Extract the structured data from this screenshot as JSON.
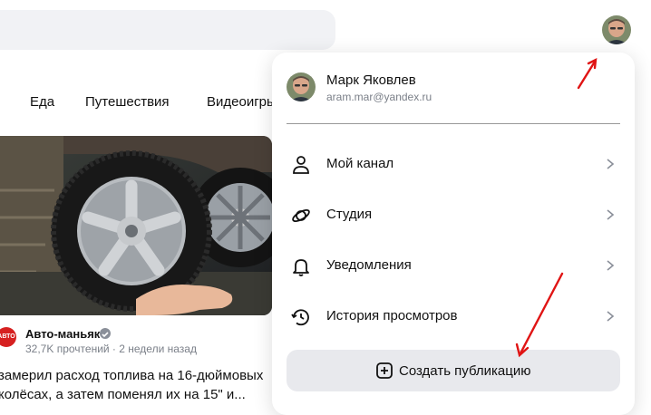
{
  "header": {
    "search_icon": "search-bar",
    "avatar_icon": "user-avatar"
  },
  "tabs": [
    {
      "label": "Еда"
    },
    {
      "label": "Путешествия"
    },
    {
      "label": "Видеоигры"
    }
  ],
  "article": {
    "channel_logo_text": "АВТО",
    "channel_name": "Авто-маньяк",
    "meta": "32,7K прочтений · 2 недели назад",
    "title_line1": "замерил расход топлива на 16-дюймовых",
    "title_line2": "колёсах, а затем поменял их на 15\" и..."
  },
  "menu": {
    "user_name": "Марк Яковлев",
    "user_email": "aram.mar@yandex.ru",
    "items": [
      {
        "label": "Мой канал",
        "icon": "person-icon"
      },
      {
        "label": "Студия",
        "icon": "studio-icon"
      },
      {
        "label": "Уведомления",
        "icon": "bell-icon"
      },
      {
        "label": "История просмотров",
        "icon": "history-icon"
      }
    ],
    "create_label": "Создать публикацию"
  },
  "colors": {
    "annotation_arrow": "#e01414",
    "search_bg": "#f1f2f5",
    "button_bg": "#e8e9ed"
  }
}
